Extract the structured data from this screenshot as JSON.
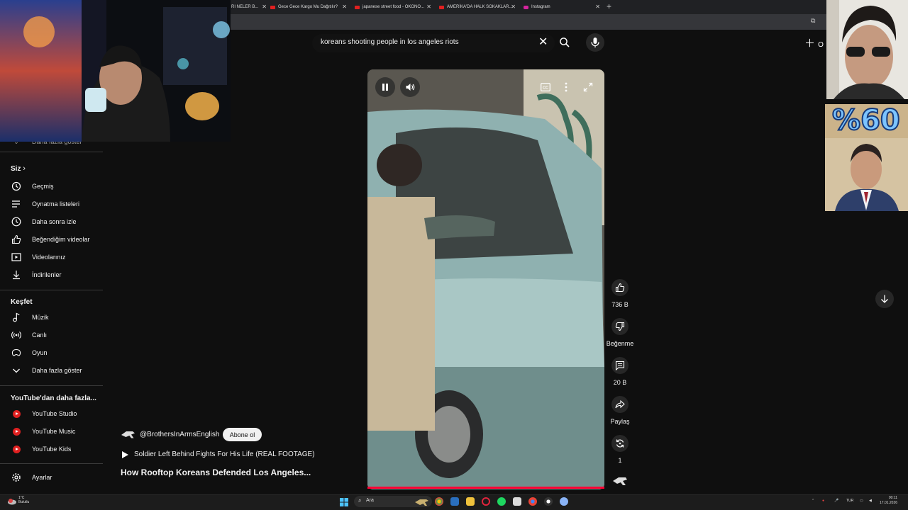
{
  "browser": {
    "tabs": [
      {
        "label": "RI NELER B...",
        "favicon": "youtube-favicon"
      },
      {
        "label": "Gece Gece Kargo Mu Dağıtılır?",
        "favicon": "youtube-favicon"
      },
      {
        "label": "japanese street food - OKONO...",
        "favicon": "youtube-favicon"
      },
      {
        "label": "AMERİKA'DA HALK SOKAKLAR...",
        "favicon": "youtube-favicon"
      },
      {
        "label": "Instagram",
        "favicon": "instagram-favicon"
      }
    ]
  },
  "search": {
    "query": "koreans shooting people in los angeles riots"
  },
  "header": {
    "create_label": "O"
  },
  "sidebar": {
    "show_more_top": "Daha fazla göster",
    "you_heading": "Siz",
    "you_items": [
      {
        "label": "Geçmiş",
        "icon": "history-icon"
      },
      {
        "label": "Oynatma listeleri",
        "icon": "playlists-icon"
      },
      {
        "label": "Daha sonra izle",
        "icon": "clock-icon"
      },
      {
        "label": "Beğendiğim videolar",
        "icon": "thumb-up-icon"
      },
      {
        "label": "Videolarınız",
        "icon": "video-icon"
      },
      {
        "label": "İndirilenler",
        "icon": "download-icon"
      }
    ],
    "explore_heading": "Keşfet",
    "explore_items": [
      {
        "label": "Müzik",
        "icon": "music-icon"
      },
      {
        "label": "Canlı",
        "icon": "live-icon"
      },
      {
        "label": "Oyun",
        "icon": "gaming-icon"
      },
      {
        "label": "Daha fazla göster",
        "icon": "chevron-down-icon"
      }
    ],
    "more_heading": "YouTube'dan daha fazla...",
    "more_items": [
      {
        "label": "YouTube Studio"
      },
      {
        "label": "YouTube Music"
      },
      {
        "label": "YouTube Kids"
      }
    ],
    "settings_label": "Ayarlar"
  },
  "actions": {
    "like_count": "736 B",
    "dislike_label": "Beğenme",
    "comment_count": "20 B",
    "share_label": "Paylaş",
    "remix_count": "1"
  },
  "video": {
    "channel": "@BrothersInArmsEnglish",
    "subscribe_label": "Abone ol",
    "playlist_title": "Soldier Left Behind Fights For His Life (REAL FOOTAGE)",
    "title": "How Rooftop Koreans Defended Los Angeles..."
  },
  "overlay": {
    "poll_text": "%60"
  },
  "taskbar": {
    "temp": "1°C",
    "weather": "Bulutlu",
    "search_placeholder": "Ara",
    "language": "TUR",
    "time": "00:11",
    "date": "17.01.2026"
  },
  "colors": {
    "background": "#0f0f0f",
    "accent_red": "#ff0033",
    "text": "#f1f1f1"
  }
}
